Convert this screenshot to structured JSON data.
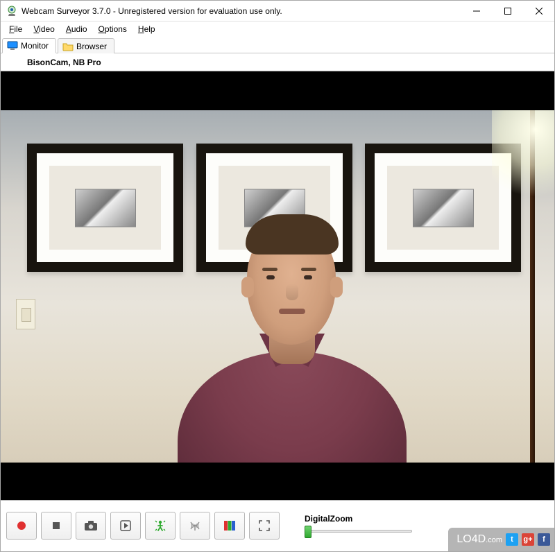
{
  "window": {
    "title": "Webcam Surveyor 3.7.0 - Unregistered version for evaluation use only."
  },
  "menu": {
    "file": "File",
    "video": "Video",
    "audio": "Audio",
    "options": "Options",
    "help": "Help"
  },
  "tabs": {
    "monitor": "Monitor",
    "browser": "Browser"
  },
  "camera": {
    "name": "BisonCam, NB Pro"
  },
  "toolbar": {
    "record": "Record",
    "stop": "Stop",
    "snapshot": "Snapshot",
    "play": "Play",
    "motion": "Motion Detection",
    "broadcast": "Broadcast",
    "adjust": "Video Adjustments",
    "fullscreen": "Fullscreen"
  },
  "zoom": {
    "label": "DigitalZoom",
    "value": 0,
    "min": 0,
    "max": 100
  },
  "watermark": {
    "brand": "LO4D",
    "suffix": ".com",
    "twitter": "t",
    "gplus": "g+",
    "facebook": "f"
  }
}
